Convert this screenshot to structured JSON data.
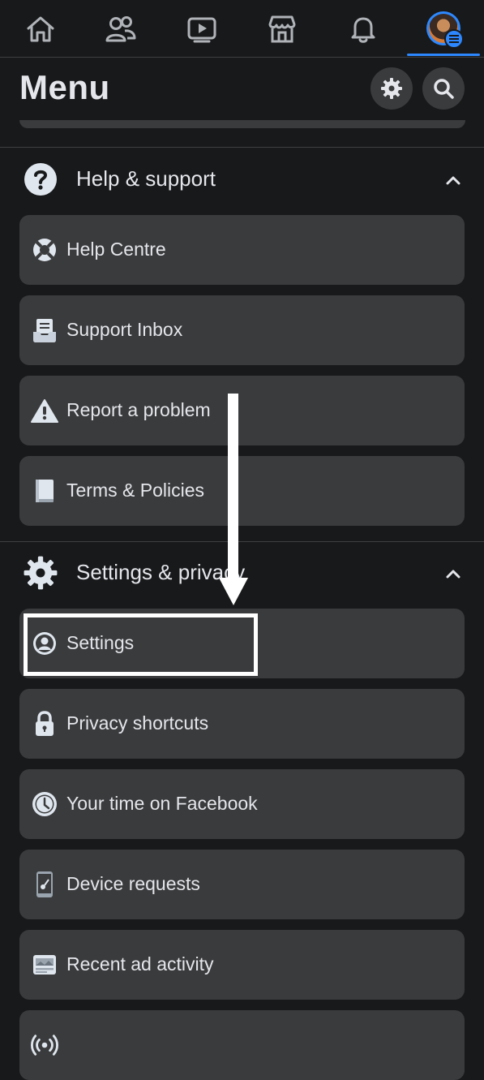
{
  "nav": {
    "items": [
      "home-icon",
      "friends-icon",
      "watch-icon",
      "marketplace-icon",
      "notifications-icon",
      "profile-menu-avatar"
    ],
    "active_color": "#2d88ff"
  },
  "header": {
    "title": "Menu",
    "settings_icon": "gear-icon",
    "search_icon": "search-icon"
  },
  "sections": {
    "help": {
      "label": "Help & support",
      "icon": "question-icon",
      "expanded": true,
      "items": [
        {
          "label": "Help Centre",
          "icon": "lifebuoy-icon"
        },
        {
          "label": "Support Inbox",
          "icon": "inbox-icon"
        },
        {
          "label": "Report a problem",
          "icon": "warning-icon"
        },
        {
          "label": "Terms & Policies",
          "icon": "book-icon"
        }
      ]
    },
    "settings": {
      "label": "Settings & privacy",
      "icon": "gear-icon",
      "expanded": true,
      "items": [
        {
          "label": "Settings",
          "icon": "user-circle-icon"
        },
        {
          "label": "Privacy shortcuts",
          "icon": "lock-icon"
        },
        {
          "label": "Your time on Facebook",
          "icon": "clock-icon"
        },
        {
          "label": "Device requests",
          "icon": "phone-key-icon"
        },
        {
          "label": "Recent ad activity",
          "icon": "ad-icon"
        },
        {
          "label": "",
          "icon": "broadcast-icon"
        }
      ]
    }
  },
  "annotation": {
    "highlight_color": "#ffffff",
    "target": "Settings"
  },
  "colors": {
    "background": "#18191a",
    "card": "#3a3b3c",
    "text": "#e4e6eb",
    "accent": "#2d88ff"
  }
}
